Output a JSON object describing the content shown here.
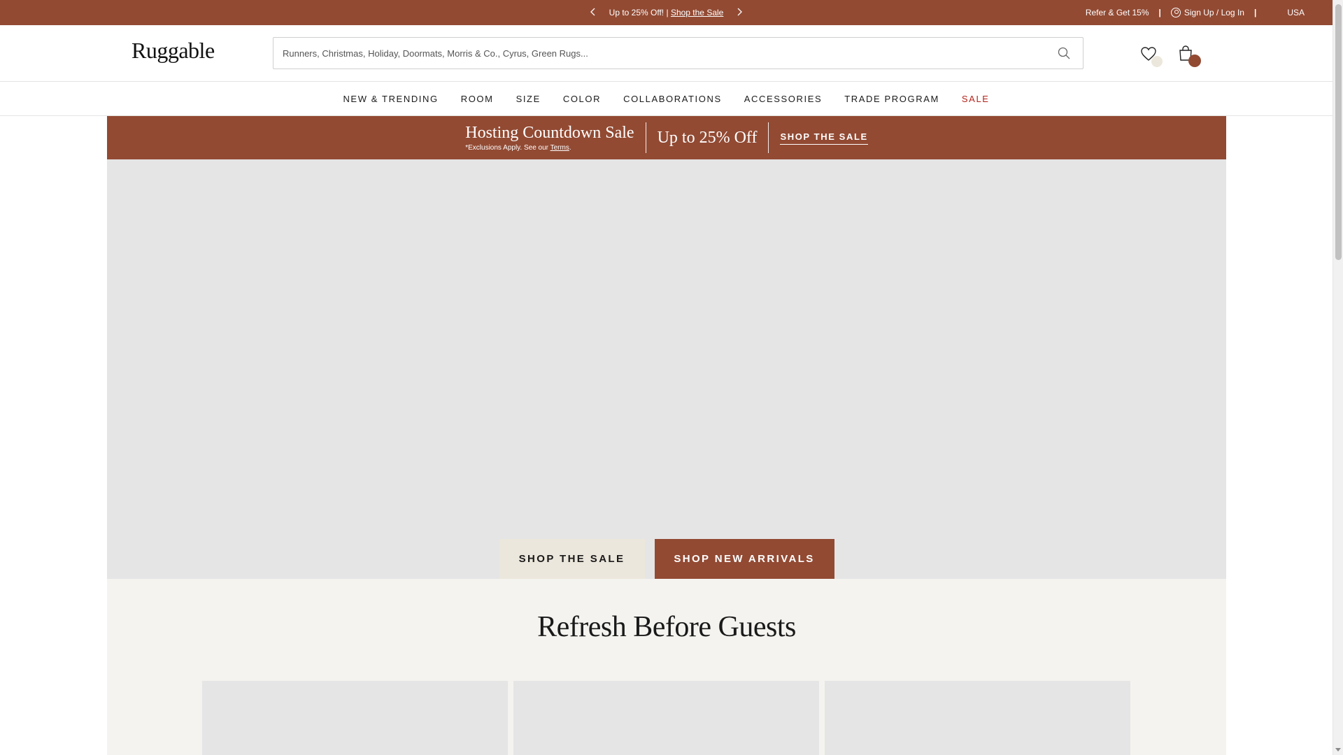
{
  "topbar": {
    "promo_text": "Up to 25% Off! | ",
    "promo_link": "Shop the Sale",
    "refer": "Refer & Get 15%",
    "separator": "|",
    "signup": "Sign Up / Log In",
    "country": "USA"
  },
  "header": {
    "logo": "Ruggable",
    "search_placeholder": "Runners, Christmas, Holiday, Doormats, Morris & Co., Cyrus, Green Rugs..."
  },
  "nav": {
    "items": [
      "NEW & TRENDING",
      "ROOM",
      "SIZE",
      "COLOR",
      "COLLABORATIONS",
      "ACCESSORIES",
      "TRADE PROGRAM",
      "SALE"
    ]
  },
  "sale_banner": {
    "title": "Hosting Countdown Sale",
    "note_prefix": "*Exclusions Apply. See our ",
    "note_link": "Terms",
    "note_suffix": ".",
    "offer": "Up to 25% Off",
    "cta": "SHOP THE SALE"
  },
  "hero": {
    "button_primary": "SHOP THE SALE",
    "button_secondary": "SHOP NEW ARRIVALS"
  },
  "section": {
    "title": "Refresh Before Guests"
  },
  "colors": {
    "brand": "#924a33",
    "sale_red": "#b3231b",
    "beige": "#ece7dc",
    "section_bg": "#f4f3ef",
    "placeholder_gray": "#e5e5e5"
  },
  "icons": [
    "chevron-left-icon",
    "chevron-right-icon",
    "user-icon",
    "search-icon",
    "heart-icon",
    "bag-icon"
  ]
}
